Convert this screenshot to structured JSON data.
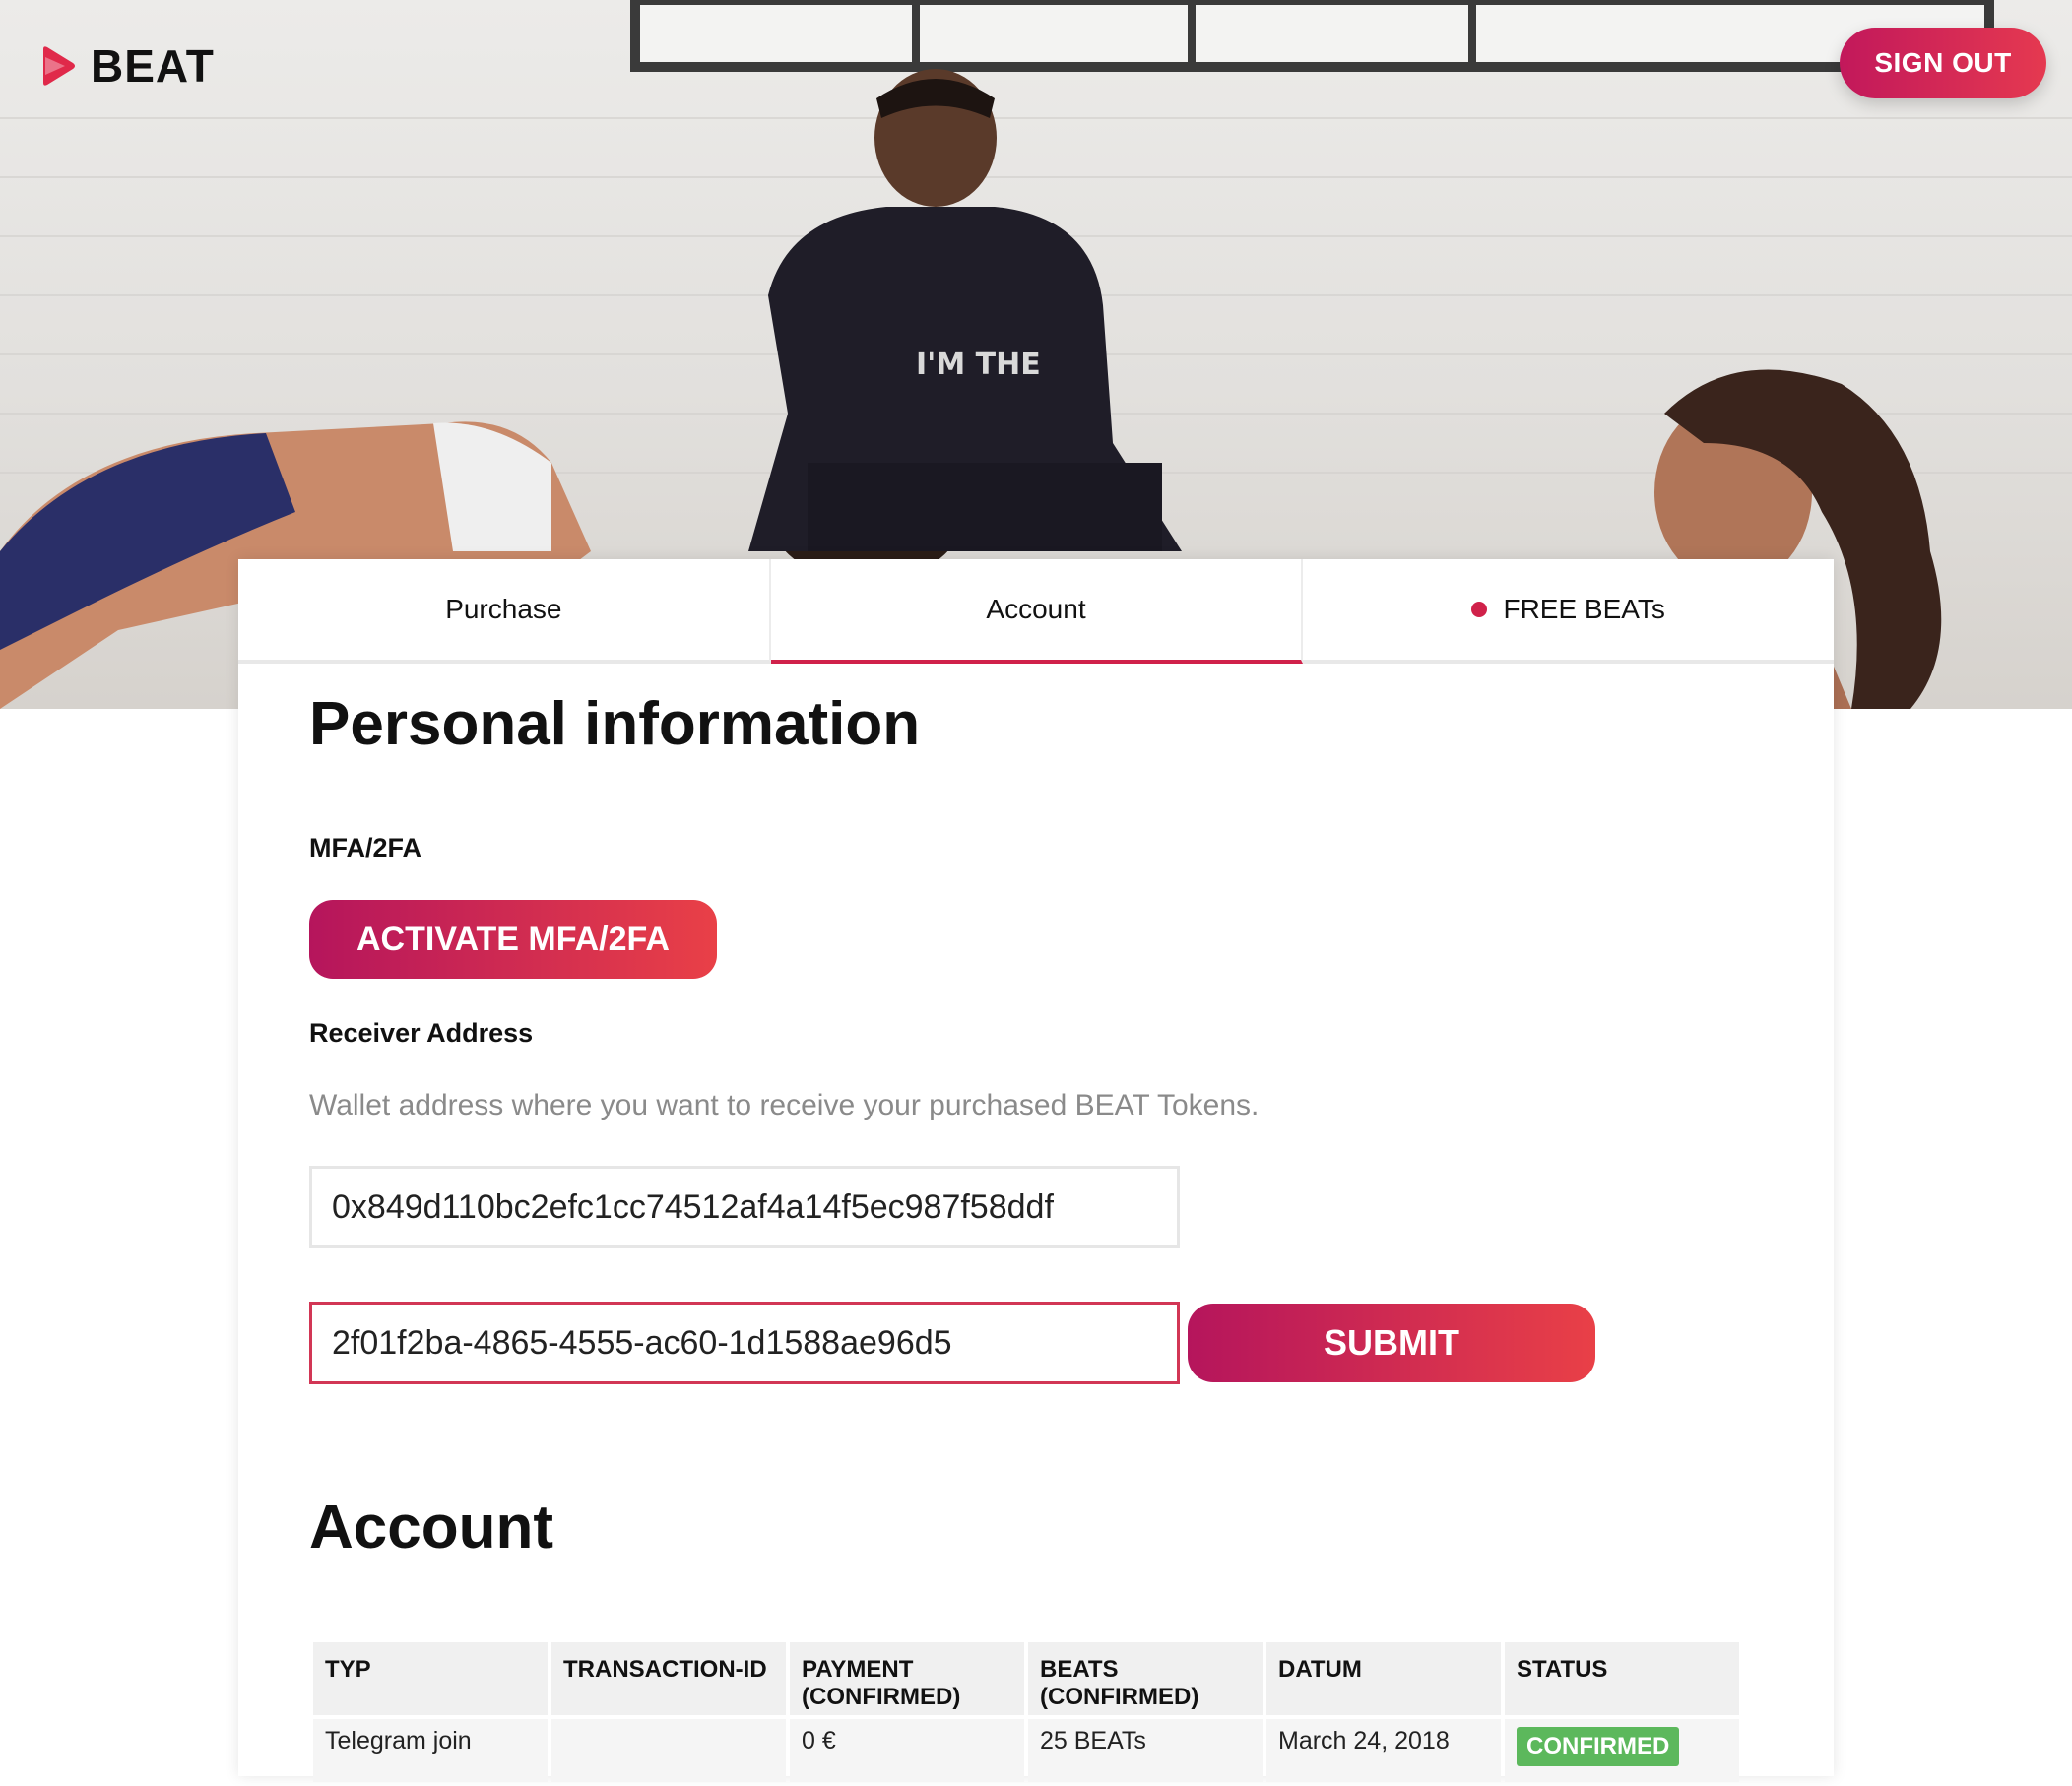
{
  "brand": {
    "name": "BEAT",
    "accent": "#d0214a",
    "gradient_start": "#b5155c",
    "gradient_end": "#e94047"
  },
  "header": {
    "signout_label": "SIGN OUT"
  },
  "tabs": [
    {
      "label": "Purchase",
      "active": false
    },
    {
      "label": "Account",
      "active": true
    },
    {
      "label": "FREE BEATs",
      "active": false,
      "indicator": "red-dot"
    }
  ],
  "personal": {
    "title": "Personal information",
    "mfa_label": "MFA/2FA",
    "mfa_button": "ACTIVATE MFA/2FA",
    "receiver_label": "Receiver Address",
    "receiver_help": "Wallet address where you want to receive your purchased BEAT Tokens.",
    "wallet_address": "0x849d110bc2efc1cc74512af4a14f5ec987f58ddf",
    "code_value": "2f01f2ba-4865-4555-ac60-1d1588ae96d5",
    "submit_label": "SUBMIT"
  },
  "account": {
    "title": "Account",
    "columns": [
      "TYP",
      "TRANSACTION-ID",
      "PAYMENT (CONFIRMED)",
      "BEATS (CONFIRMED)",
      "DATUM",
      "STATUS"
    ],
    "rows": [
      {
        "typ": "Telegram join",
        "transaction_id": "",
        "payment": "0 €",
        "beats": "25 BEATs",
        "datum": "March 24, 2018",
        "status": "CONFIRMED",
        "status_color": "#5cb85c"
      }
    ]
  }
}
